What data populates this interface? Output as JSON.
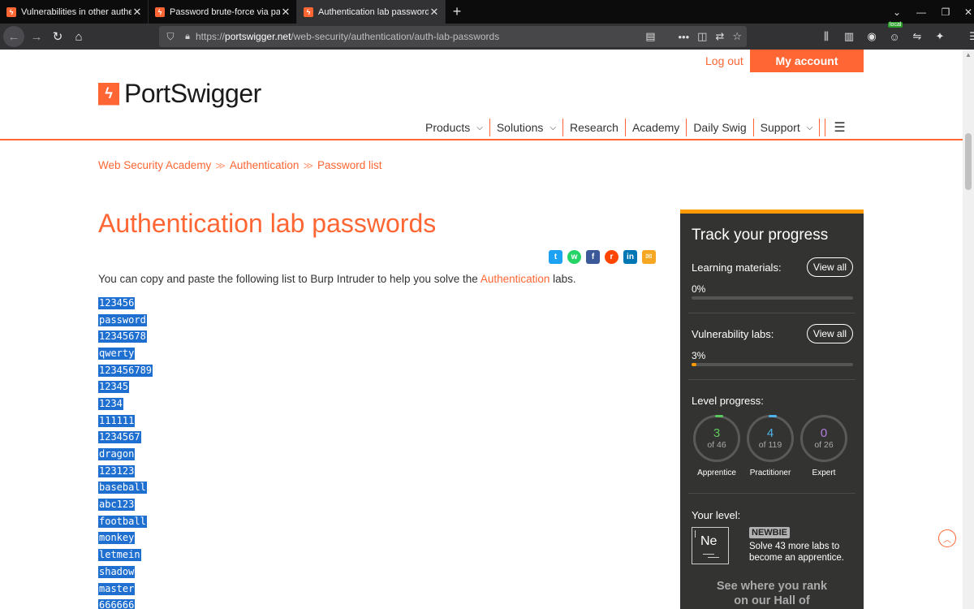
{
  "browser": {
    "tabs": [
      {
        "title": "Vulnerabilities in other authenti",
        "active": false
      },
      {
        "title": "Password brute-force via passw",
        "active": false
      },
      {
        "title": "Authentication lab passwords |",
        "active": true
      }
    ],
    "url_prefix": "https://",
    "url_host": "portswigger.net",
    "url_path": "/web-security/authentication/auth-lab-passwords",
    "local_badge": "local"
  },
  "header": {
    "logout": "Log out",
    "my_account": "My account",
    "logo_text": "PortSwigger",
    "nav": [
      {
        "label": "Products",
        "has_menu": true
      },
      {
        "label": "Solutions",
        "has_menu": true
      },
      {
        "label": "Research",
        "has_menu": false
      },
      {
        "label": "Academy",
        "has_menu": false
      },
      {
        "label": "Daily Swig",
        "has_menu": false
      },
      {
        "label": "Support",
        "has_menu": true
      }
    ]
  },
  "breadcrumb": [
    "Web Security Academy",
    "Authentication",
    "Password list"
  ],
  "main": {
    "title": "Authentication lab passwords",
    "intro_before": "You can copy and paste the following list to Burp Intruder to help you solve the ",
    "intro_link": "Authentication",
    "intro_after": " labs.",
    "passwords": [
      "123456",
      "password",
      "12345678",
      "qwerty",
      "123456789",
      "12345",
      "1234",
      "111111",
      "1234567",
      "dragon",
      "123123",
      "baseball",
      "abc123",
      "football",
      "monkey",
      "letmein",
      "shadow",
      "master",
      "666666"
    ]
  },
  "progress": {
    "title": "Track your progress",
    "learning_label": "Learning materials:",
    "learning_pct": "0%",
    "learning_fraction": 0,
    "labs_label": "Vulnerability labs:",
    "labs_pct": "3%",
    "labs_fraction": 0.03,
    "view_all": "View all",
    "level_progress_label": "Level progress:",
    "levels": [
      {
        "num": "3",
        "of": "of 46",
        "name": "Apprentice",
        "color": "#5cc95c"
      },
      {
        "num": "4",
        "of": "of 119",
        "name": "Practitioner",
        "color": "#4fb3e8"
      },
      {
        "num": "0",
        "of": "of 26",
        "name": "Expert",
        "color": "#b57fe0"
      }
    ],
    "your_level_label": "Your level:",
    "element_symbol": "Ne",
    "rank_badge": "NEWBIE",
    "rank_text": "Solve 43 more labs to become an apprentice.",
    "hall_of_fame_line1": "See where you rank",
    "hall_of_fame_line2": "on our Hall of"
  },
  "colors": {
    "brand": "#ff6633",
    "panel_bg": "#333332",
    "panel_accent": "#ff9900",
    "selection": "#1f6fd1"
  }
}
